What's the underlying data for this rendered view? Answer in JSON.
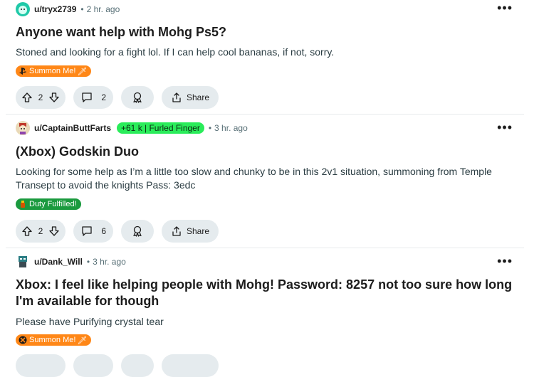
{
  "posts": [
    {
      "user": "u/tryx2739",
      "time": "2 hr. ago",
      "user_flair": "",
      "title": "Anyone want help with Mohg Ps5?",
      "body": "Stoned and looking for a fight lol. If I can help cool bananas, if not, sorry.",
      "post_flair": "Summon Me!",
      "votes": "2",
      "comments": "2",
      "share": "Share",
      "avatar_color": "#1fc9a8"
    },
    {
      "user": "u/CaptainButtFarts",
      "time": "3 hr. ago",
      "user_flair": "+61 k | Furled Finger",
      "title": "(Xbox) Godskin Duo",
      "body": "Looking for some help as I’m a little too slow and chunky to be in this 2v1 situation, summoning from Temple Transept to avoid the knights Pass: 3edc",
      "post_flair": "Duty Fulfilled!",
      "votes": "2",
      "comments": "6",
      "share": "Share",
      "avatar_color": "#e9d9b8"
    },
    {
      "user": "u/Dank_Will",
      "time": "3 hr. ago",
      "user_flair": "",
      "title": "Xbox: I feel like helping people with Mohg! Password: 8257 not too sure how long I'm available for though",
      "body": "Please have Purifying crystal tear",
      "post_flair": "Summon Me!",
      "avatar_color": "#2a7d84"
    }
  ],
  "colors": {
    "summon_flair": "#ff8717",
    "fulfilled_flair": "#1a9a3e",
    "user_flair_green": "#2aec5a",
    "action_pill": "#e5ebee"
  },
  "icons": [
    "upvote-icon",
    "downvote-icon",
    "comment-icon",
    "award-icon",
    "share-icon",
    "more-options-icon",
    "playstation-icon",
    "xbox-icon"
  ]
}
